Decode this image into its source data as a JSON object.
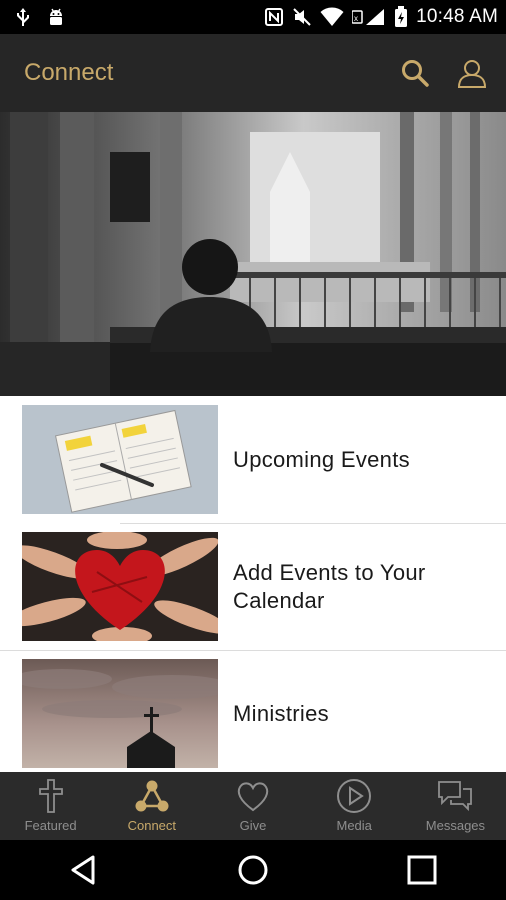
{
  "status_bar": {
    "time": "10:48 AM",
    "icons": [
      "usb-icon",
      "android-icon",
      "nfc-icon",
      "mute-icon",
      "wifi-icon",
      "signal-icon",
      "battery-icon"
    ]
  },
  "app_bar": {
    "title": "Connect",
    "actions": [
      "search-icon",
      "profile-icon"
    ]
  },
  "list": {
    "items": [
      {
        "label": "Upcoming Events",
        "thumb": "calendar-notebook-image"
      },
      {
        "label": "Add Events to Your Calendar",
        "thumb": "hands-heart-image"
      },
      {
        "label": "Ministries",
        "thumb": "church-steeple-image"
      }
    ]
  },
  "tabs": [
    {
      "label": "Featured",
      "icon": "cross-icon",
      "active": false
    },
    {
      "label": "Connect",
      "icon": "connect-nodes-icon",
      "active": true
    },
    {
      "label": "Give",
      "icon": "heart-icon",
      "active": false
    },
    {
      "label": "Media",
      "icon": "play-icon",
      "active": false
    },
    {
      "label": "Messages",
      "icon": "chat-bubbles-icon",
      "active": false
    }
  ],
  "colors": {
    "accent": "#c8a96a",
    "app_bar": "#262626",
    "tab_bar": "#2b2b2b",
    "inactive": "#8e8e8e"
  }
}
